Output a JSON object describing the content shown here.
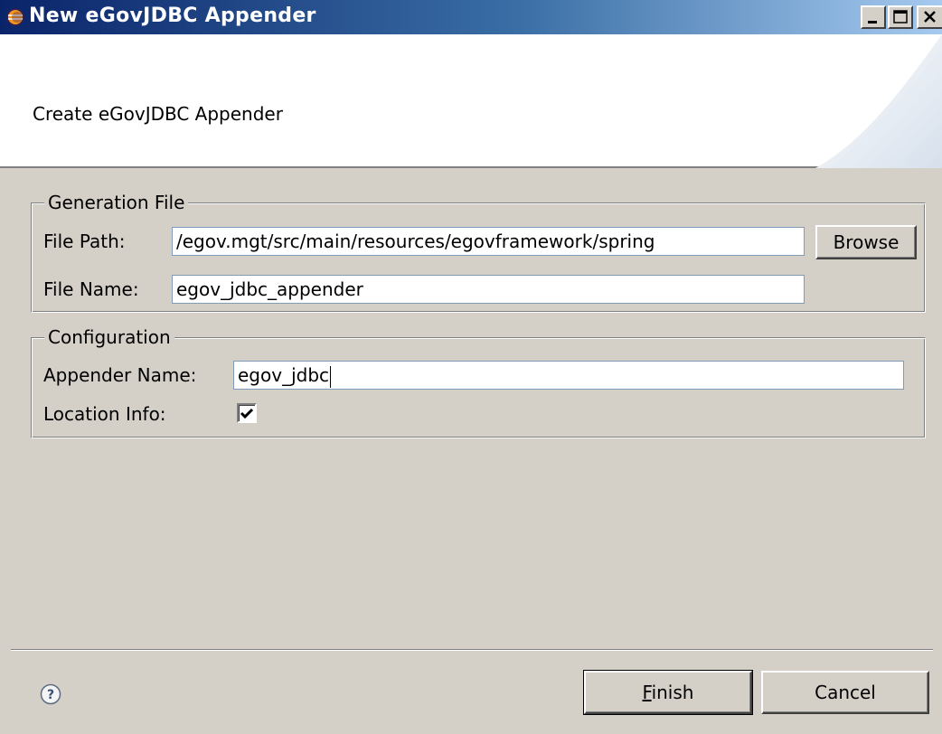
{
  "window": {
    "title": "New eGovJDBC Appender"
  },
  "banner": {
    "description": "Create eGovJDBC Appender"
  },
  "generation_file": {
    "group_title": "Generation File",
    "file_path_label": "File Path:",
    "file_path_value": "/egov.mgt/src/main/resources/egovframework/spring",
    "browse_label": "Browse",
    "file_name_label": "File Name:",
    "file_name_value": "egov_jdbc_appender"
  },
  "configuration": {
    "group_title": "Configuration",
    "appender_name_label": "Appender Name:",
    "appender_name_value": "egov_jdbc",
    "location_info_label": "Location Info:",
    "location_info_checked": true
  },
  "footer": {
    "finish_label": "Finish",
    "finish_mnemonic": "F",
    "finish_rest": "inish",
    "cancel_label": "Cancel"
  },
  "colors": {
    "titlebar_start": "#0a246a",
    "titlebar_end": "#a6caf0",
    "dialog_bg": "#d4d0c8"
  },
  "icons": [
    "eclipse-icon",
    "minimize-icon",
    "maximize-icon",
    "close-icon",
    "help-icon",
    "checkmark-icon"
  ]
}
